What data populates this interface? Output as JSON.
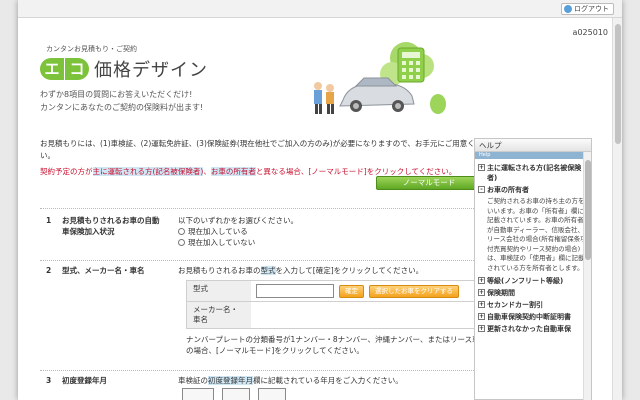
{
  "header": {
    "logout_label": "ログアウト",
    "page_id": "a025010"
  },
  "logo": {
    "tag": "カンタンお見積もり・ご契約",
    "mark_chars": [
      "エ",
      "コ"
    ],
    "text": "価格デザイン"
  },
  "tagline": {
    "line1": "わずか8項目の質問にお答えいただくだけ!",
    "line2": "カンタンにあなたのご契約の保険料が出ます!"
  },
  "intro": {
    "text": "お見積もりには、(1)車検証、(2)運転免許証、(3)保険証券(現在他社でご加入の方のみ)が必要になりますので、お手元にご用意ください。",
    "warn_prefix": "契約予定の方が",
    "warn_hl1": "主に運転される方(記名被保険者)",
    "warn_mid": "、",
    "warn_hl2": "お車の所有者",
    "warn_suffix": "と異なる場合、[ノーマルモード]をクリックしてください。",
    "normal_mode_label": "ノーマルモード"
  },
  "sections": [
    {
      "num": "1",
      "title": "お見積もりされるお車の自動車保険加入状況",
      "instruction": "以下のいずれかをお選びください。",
      "options": [
        "現在加入している",
        "現在加入していない"
      ]
    },
    {
      "num": "2",
      "title": "型式、メーカー名・車名",
      "instruction_pre": "お見積もりされるお車の",
      "instruction_hl": "型式",
      "instruction_post": "を入力して[確定]をクリックしてください。",
      "field_model_label": "型式",
      "field_maker_label": "メーカー名・車名",
      "confirm_label": "確定",
      "clear_label": "選択したお車をクリアする",
      "note": "ナンバープレートの分類番号が1ナンバー・8ナンバー、沖縄ナンバー、またはリース車の場合、[ノーマルモード]をクリックしてください。"
    },
    {
      "num": "3",
      "title": "初度登録年月",
      "instruction_pre": "車検証の",
      "instruction_hl": "初度登録年月",
      "instruction_post": "欄に記載されている年月をご入力ください。"
    }
  ],
  "help": {
    "title": "ヘルプ",
    "sub": "Help",
    "items": [
      {
        "mark": "+",
        "label": "主に運転される方(記名被保険者)"
      },
      {
        "mark": "-",
        "label": "お車の所有者"
      },
      {
        "mark": "+",
        "label": "等級(ノンフリート等級)"
      },
      {
        "mark": "+",
        "label": "保険期間"
      },
      {
        "mark": "+",
        "label": "セカンドカー割引"
      },
      {
        "mark": "+",
        "label": "自動車保険契約中断証明書"
      },
      {
        "mark": "+",
        "label": "更新されなかった自動車保"
      }
    ],
    "owner_desc": "ご契約されるお車の持ち主の方をいいます。お車の「所有者」欄に記載されています。お車の所有者が自動車ディーラー、信販会社、リース会社の場合(所有権留保条項付売買契約やリース契約の場合)は、車検証の「使用者」欄に記載されている方を所有者とします。"
  }
}
